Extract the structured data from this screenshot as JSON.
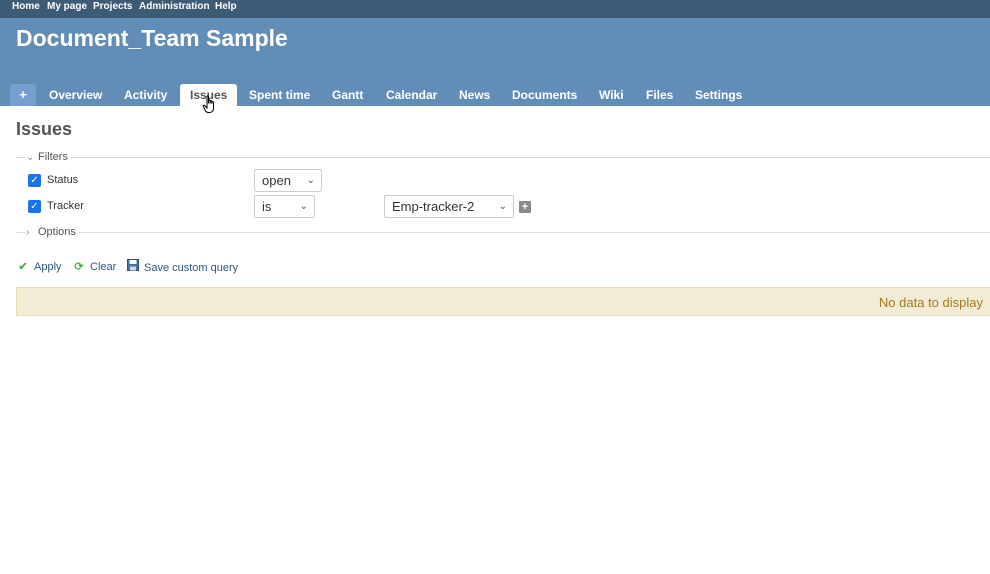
{
  "top_menu": [
    "Home",
    "My page",
    "Projects",
    "Administration",
    "Help"
  ],
  "project": {
    "title": "Document_Team Sample"
  },
  "tabs": {
    "new": "+",
    "items": [
      "Overview",
      "Activity",
      "Issues",
      "Spent time",
      "Gantt",
      "Calendar",
      "News",
      "Documents",
      "Wiki",
      "Files",
      "Settings"
    ],
    "selected": "Issues"
  },
  "page": {
    "title": "Issues"
  },
  "filters": {
    "legend": "Filters",
    "rows": [
      {
        "checked": true,
        "label": "Status",
        "operator": "open"
      },
      {
        "checked": true,
        "label": "Tracker",
        "operator": "is",
        "value": "Emp-tracker-2"
      }
    ]
  },
  "options": {
    "legend": "Options"
  },
  "actions": {
    "apply": "Apply",
    "clear": "Clear",
    "save": "Save custom query"
  },
  "results": {
    "empty_message": "No data to display"
  },
  "colors": {
    "top_menu": "#3e5b76",
    "header": "#628db6",
    "link": "#2a5685",
    "nodata_bg": "#f2ecd4",
    "nodata_text": "#a27a1c"
  }
}
